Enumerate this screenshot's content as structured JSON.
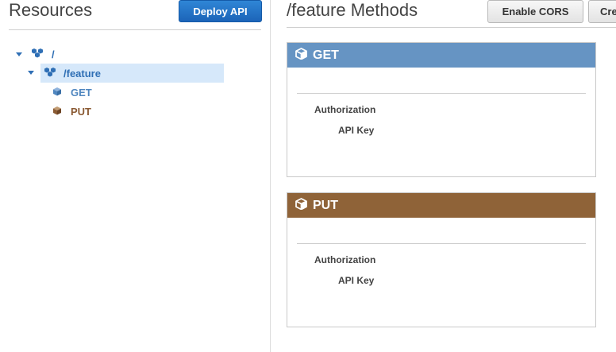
{
  "left": {
    "title": "Resources",
    "deploy_label": "Deploy API",
    "tree": [
      {
        "label": "/",
        "color": "#2f6fb5"
      },
      {
        "label": "/feature",
        "color": "#2f6fb5",
        "selected": true
      },
      {
        "label": "GET",
        "color": "#4f86bf"
      },
      {
        "label": "PUT",
        "color": "#8a5a33"
      }
    ]
  },
  "right": {
    "title": "/feature Methods",
    "enable_cors_label": "Enable CORS",
    "create_label": "Create",
    "methods": [
      {
        "name": "GET",
        "header_color": "#6694c3",
        "auth_label": "Authorization",
        "auth_value": "API Key"
      },
      {
        "name": "PUT",
        "header_color": "#8f6338",
        "auth_label": "Authorization",
        "auth_value": "API Key"
      }
    ]
  },
  "colors": {
    "selected_row": "#d6e8fa",
    "accent": "#1c64b8"
  }
}
